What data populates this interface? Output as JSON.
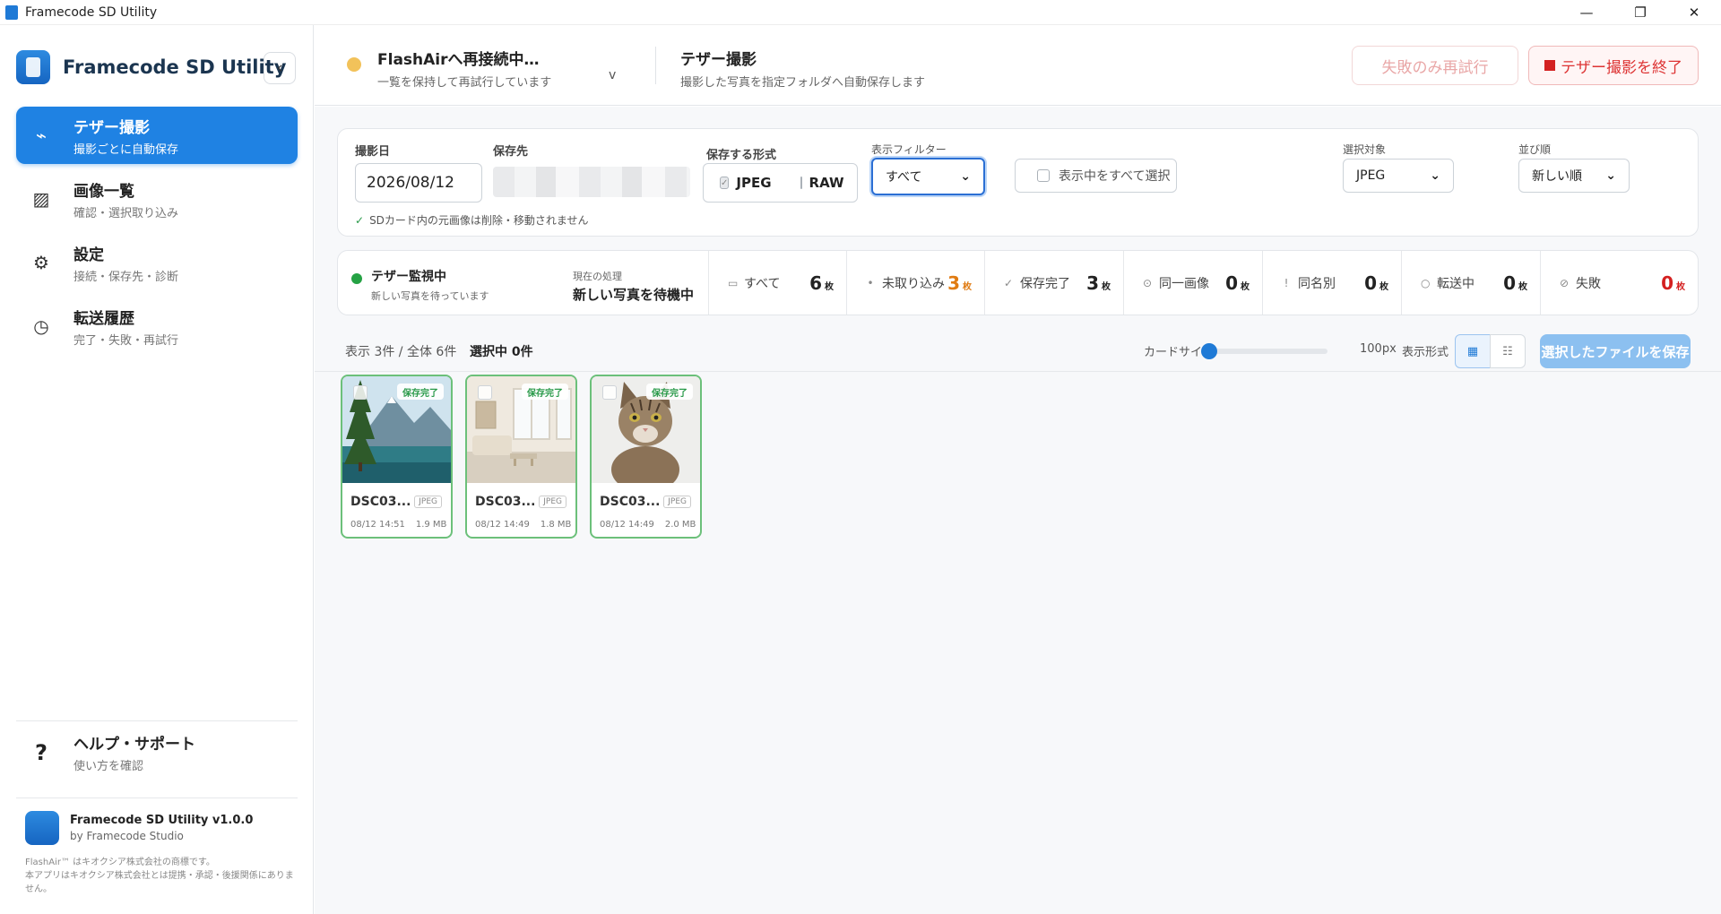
{
  "titlebar": {
    "title": "Framecode SD Utility",
    "minimize": "—",
    "restore": "❐",
    "close": "✕"
  },
  "sidebar": {
    "brand": "Framecode SD Utility",
    "collapse": "‹",
    "items": [
      {
        "icon": "link-icon",
        "glyph": "⌁",
        "label": "テザー撮影",
        "sub": "撮影ごとに自動保存",
        "active": true
      },
      {
        "icon": "image-grid-icon",
        "glyph": "▨",
        "label": "画像一覧",
        "sub": "確認・選択取り込み"
      },
      {
        "icon": "gear-icon",
        "glyph": "⚙",
        "label": "設定",
        "sub": "接続・保存先・診断"
      },
      {
        "icon": "clock-icon",
        "glyph": "◷",
        "label": "転送履歴",
        "sub": "完了・失敗・再試行"
      }
    ],
    "help": {
      "glyph": "?",
      "label": "ヘルプ・サポート",
      "sub": "使い方を確認"
    },
    "footer": {
      "name": "Framecode SD Utility v1.0.0",
      "by": "by Framecode Studio",
      "note1": "FlashAir™ はキオクシア株式会社の商標です。",
      "note2": "本アプリはキオクシア株式会社とは提携・承認・後援関係にありません。"
    }
  },
  "header": {
    "conn_title": "FlashAirへ再接続中…",
    "conn_sub": "一覧を保持して再試行しています",
    "conn_chevron": "v",
    "mode_title": "テザー撮影",
    "mode_sub": "撮影した写真を指定フォルダへ自動保存します",
    "retry_label": "失敗のみ再試行",
    "stop_label": "テザー撮影を終了",
    "colors": {
      "connecting": "#f2c25a",
      "stop": "#d32222"
    }
  },
  "filters": {
    "date_label": "撮影日",
    "date_value": "2026/08/12",
    "dest_label": "保存先",
    "note": "SDカード内の元画像は削除・移動されません",
    "note_check": "✓",
    "format_label": "保存する形式",
    "formats": [
      {
        "label": "JPEG",
        "checked": true,
        "mark": "✓"
      },
      {
        "label": "RAW",
        "checked": false,
        "mark": ""
      }
    ],
    "filter_label": "表示フィルター",
    "filter_value": "すべて",
    "select_all_label": "表示中をすべて選択",
    "target_label": "選択対象",
    "target_value": "JPEG",
    "sort_label": "並び順",
    "sort_value": "新しい順",
    "chevron": "⌄"
  },
  "status": {
    "monitor_title": "テザー監視中",
    "monitor_sub": "新しい写真を待っています",
    "proc_label": "現在の処理",
    "proc_value": "新しい写真を待機中",
    "stats": [
      {
        "icon": "all-icon",
        "glyph": "▭",
        "label": "すべて",
        "value": "6",
        "unit": "枚",
        "color": "normal"
      },
      {
        "icon": "pending-icon",
        "glyph": "•",
        "label": "未取り込み",
        "value": "3",
        "unit": "枚",
        "color": "orange"
      },
      {
        "icon": "check-icon",
        "glyph": "✓",
        "label": "保存完了",
        "value": "3",
        "unit": "枚",
        "color": "normal"
      },
      {
        "icon": "duplicate-icon",
        "glyph": "⊙",
        "label": "同一画像",
        "value": "0",
        "unit": "枚",
        "color": "normal"
      },
      {
        "icon": "warning-icon",
        "glyph": "!",
        "label": "同名別",
        "value": "0",
        "unit": "枚",
        "color": "normal"
      },
      {
        "icon": "transfer-icon",
        "glyph": "○",
        "label": "転送中",
        "value": "0",
        "unit": "枚",
        "color": "normal"
      },
      {
        "icon": "fail-icon",
        "glyph": "⊘",
        "label": "失敗",
        "value": "0",
        "unit": "枚",
        "color": "red"
      }
    ]
  },
  "toolbar": {
    "count": "表示 3件 / 全体 6件",
    "selected": "選択中 0件",
    "card_size_label": "カードサイズ",
    "card_size_value": "100px",
    "card_size_level": 0,
    "view_label": "表示形式",
    "grid_glyph": "▦",
    "list_glyph": "☷",
    "save_label": "選択したファイルを保存"
  },
  "cards": [
    {
      "name": "DSC03...",
      "type": "JPEG",
      "date": "08/12 14:51",
      "size": "1.9 MB",
      "badge": "保存完了",
      "thumb": "mountain-lake"
    },
    {
      "name": "DSC03...",
      "type": "JPEG",
      "date": "08/12 14:49",
      "size": "1.8 MB",
      "badge": "保存完了",
      "thumb": "living-room"
    },
    {
      "name": "DSC03...",
      "type": "JPEG",
      "date": "08/12 14:49",
      "size": "2.0 MB",
      "badge": "保存完了",
      "thumb": "cat"
    }
  ]
}
